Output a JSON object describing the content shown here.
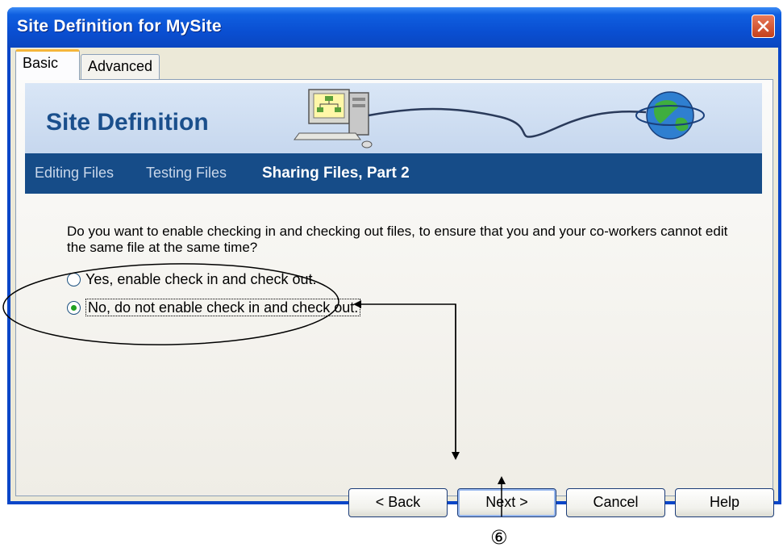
{
  "window": {
    "title": "Site Definition for MySite"
  },
  "tabs": [
    {
      "label": "Basic",
      "active": true
    },
    {
      "label": "Advanced",
      "active": false
    }
  ],
  "banner": {
    "title": "Site Definition",
    "icons": [
      "computer-icon",
      "globe-icon"
    ]
  },
  "steps": [
    {
      "label": "Editing Files",
      "active": false
    },
    {
      "label": "Testing Files",
      "active": false
    },
    {
      "label": "Sharing Files, Part 2",
      "active": true
    }
  ],
  "question": "Do you want to enable checking in and checking out files, to ensure that you and your co-workers cannot edit the same file at the same time?",
  "options": [
    {
      "label": "Yes, enable check in and check out.",
      "selected": false
    },
    {
      "label": "No, do not enable check in and check out.",
      "selected": true
    }
  ],
  "buttons": {
    "back": "< Back",
    "next": "Next >",
    "cancel": "Cancel",
    "help": "Help"
  },
  "annotation": {
    "marker": "⑥"
  },
  "colors": {
    "titlebar": "#0a4fd2",
    "stepbar": "#164c88",
    "banner_title": "#1a4f8c",
    "radio_selected": "#21a121"
  }
}
